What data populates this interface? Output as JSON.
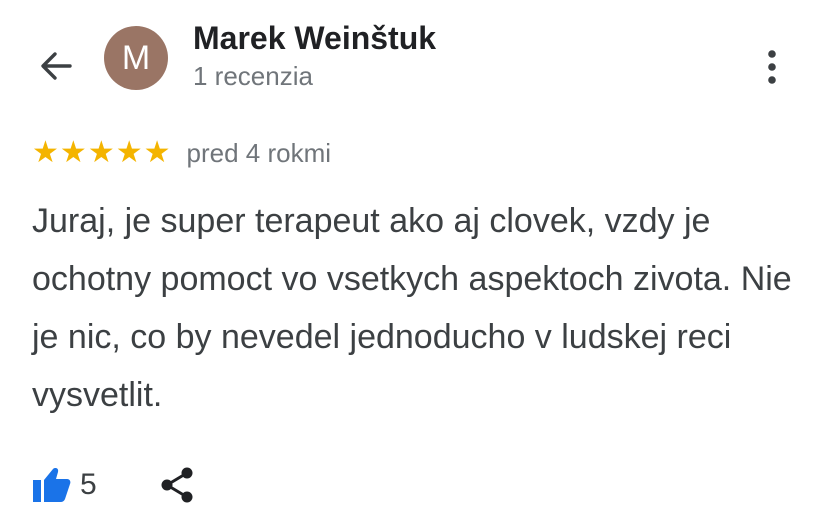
{
  "header": {
    "back_icon": "arrow-back-icon",
    "more_icon": "more-vert-icon"
  },
  "reviewer": {
    "avatar_initial": "M",
    "avatar_color": "#9a7565",
    "name": "Marek Weinštuk",
    "review_count_label": "1 recenzia"
  },
  "review": {
    "rating": 5,
    "max_rating": 5,
    "star_color": "#f4b400",
    "time_label": "pred 4 rokmi",
    "text": "Juraj, je super terapeut ako aj clovek, vzdy je ochotny pomoct vo vsetkych aspektoch zivota. Nie je nic, co by nevedel jednoducho v ludskej reci vysvetlit."
  },
  "actions": {
    "like_icon": "thumb-up-icon",
    "like_color": "#1a73e8",
    "like_count": "5",
    "share_icon": "share-icon"
  }
}
